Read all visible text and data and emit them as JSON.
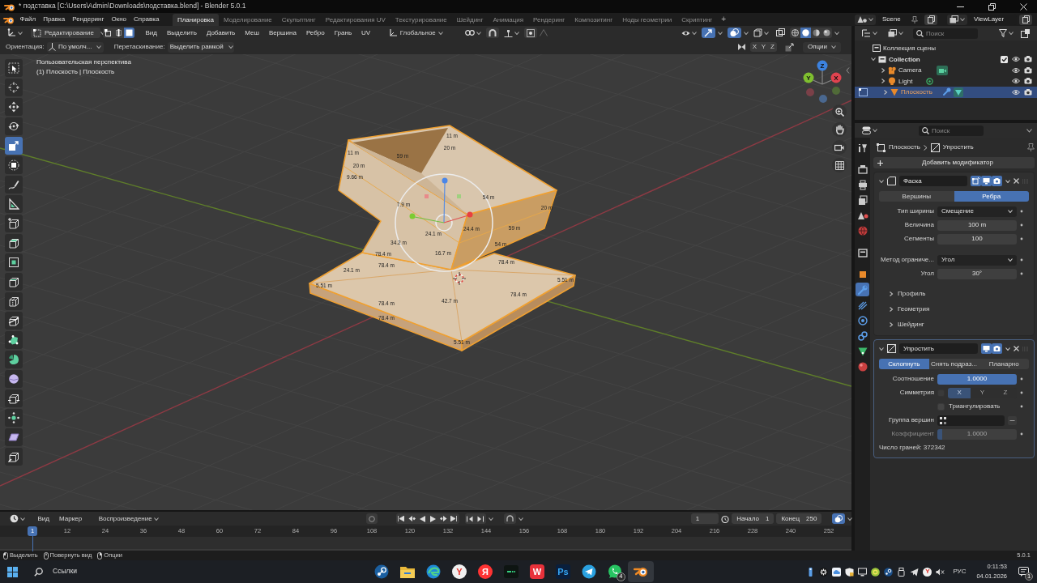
{
  "window": {
    "title": "* подставка [C:\\Users\\Admin\\Downloads\\подставка.blend] - Blender 5.0.1"
  },
  "top_bar": {
    "menus": [
      "Файл",
      "Правка",
      "Рендеринг",
      "Окно",
      "Справка"
    ],
    "workspaces": [
      {
        "label": "Планировка",
        "selected": true
      },
      {
        "label": "Моделирование",
        "selected": false
      },
      {
        "label": "Скульптинг",
        "selected": false
      },
      {
        "label": "Редактирования UV",
        "selected": false
      },
      {
        "label": "Текстурирование",
        "selected": false
      },
      {
        "label": "Шейдинг",
        "selected": false
      },
      {
        "label": "Анимация",
        "selected": false
      },
      {
        "label": "Рендеринг",
        "selected": false
      },
      {
        "label": "Композитинг",
        "selected": false
      },
      {
        "label": "Ноды геометрии",
        "selected": false
      },
      {
        "label": "Скриптинг",
        "selected": false
      }
    ],
    "add_workspace": "+",
    "scene": "Scene",
    "view_layer": "ViewLayer"
  },
  "viewport": {
    "header": {
      "mode": "Редактирование",
      "select_modes": [
        {
          "kind": "vertex",
          "selected": false
        },
        {
          "kind": "edge",
          "selected": false
        },
        {
          "kind": "face",
          "selected": true
        }
      ],
      "menus": [
        "Вид",
        "Выделить",
        "Добавить",
        "Меш",
        "Вершина",
        "Ребро",
        "Грань",
        "UV"
      ],
      "orientation": "Глобальное",
      "shading": [
        {
          "kind": "wireframe",
          "selected": false
        },
        {
          "kind": "solid",
          "selected": true
        },
        {
          "kind": "material",
          "selected": false
        },
        {
          "kind": "rendered",
          "selected": false
        }
      ]
    },
    "tool_settings": {
      "orientation_label": "Ориентация:",
      "orientation": "По умолч...",
      "drag_label": "Перетаскивание:",
      "drag": "Выделить рамкой",
      "mirror": [
        {
          "label": "X",
          "selected": false
        },
        {
          "label": "Y",
          "selected": false
        },
        {
          "label": "Z",
          "selected": false
        }
      ],
      "options": "Опции"
    },
    "view_name": "Пользовательская перспектива",
    "object_info": "(1) Плоскость | Плоскость",
    "tools": [
      {
        "kind": "select-box",
        "selected": false
      },
      {
        "kind": "cursor",
        "selected": false
      },
      {
        "kind": "move",
        "selected": false
      },
      {
        "kind": "rotate",
        "selected": false
      },
      {
        "kind": "scale",
        "selected": true
      },
      {
        "kind": "transform",
        "selected": false
      },
      {
        "kind": "annotate",
        "selected": false
      },
      {
        "kind": "measure",
        "selected": false
      },
      {
        "kind": "add-cube",
        "selected": false
      },
      {
        "kind": "extrude",
        "selected": false
      },
      {
        "kind": "inset",
        "selected": false
      },
      {
        "kind": "bevel",
        "selected": false
      },
      {
        "kind": "loop-cut",
        "selected": false
      },
      {
        "kind": "knife",
        "selected": false
      },
      {
        "kind": "poly-build",
        "selected": false
      },
      {
        "kind": "spin",
        "selected": false
      },
      {
        "kind": "smooth",
        "selected": false
      },
      {
        "kind": "edge-slide",
        "selected": false
      },
      {
        "kind": "shrink",
        "selected": false
      },
      {
        "kind": "shear",
        "selected": false
      },
      {
        "kind": "rip",
        "selected": false
      }
    ],
    "gizmo_axes": [
      {
        "kind": "z",
        "label": "Z"
      },
      {
        "kind": "y",
        "label": "Y"
      },
      {
        "kind": "x",
        "label": "X"
      }
    ],
    "measurements": [
      "59 m",
      "11 m",
      "20 m",
      "11 m",
      "20 m",
      "9.66 m",
      "7.9 m",
      "54 m",
      "20 m",
      "59 m",
      "24.1 m",
      "24.4 m",
      "34.2 m",
      "16.7 m",
      "78.4 m",
      "78.4 m",
      "78.4 m",
      "24.1 m",
      "5.51 m",
      "42.7 m",
      "78.4 m",
      "78.4 m",
      "78.4 m",
      "5.51 m",
      "5.51 m",
      "54 m"
    ]
  },
  "timeline": {
    "menus": [
      "Вид",
      "Маркер"
    ],
    "playback": "Воспроизведение",
    "current_frame": "1",
    "start_label": "Начало",
    "start": "1",
    "end_label": "Конец",
    "end": "250",
    "ruler": [
      "12",
      "24",
      "36",
      "48",
      "60",
      "72",
      "84",
      "96",
      "108",
      "120",
      "132",
      "144",
      "156",
      "168",
      "180",
      "192",
      "204",
      "216",
      "228",
      "240",
      "252"
    ],
    "cursor": "1"
  },
  "outliner": {
    "search_placeholder": "Поиск",
    "scene_collection": "Коллекция сцены",
    "collections": [
      {
        "name": "Collection",
        "expanded": true,
        "checked": true,
        "children": [
          {
            "name": "Camera",
            "kind": "camera",
            "expanded": false,
            "selected": false
          },
          {
            "name": "Light",
            "kind": "light",
            "expanded": false,
            "selected": false
          },
          {
            "name": "Плоскость",
            "kind": "mesh",
            "expanded": false,
            "selected": true
          }
        ]
      }
    ]
  },
  "properties": {
    "search_placeholder": "Поиск",
    "tabs": [
      {
        "kind": "tool",
        "selected": false
      },
      {
        "kind": "render",
        "selected": false
      },
      {
        "kind": "output",
        "selected": false
      },
      {
        "kind": "view-layer",
        "selected": false
      },
      {
        "kind": "scene",
        "selected": false
      },
      {
        "kind": "world",
        "selected": false
      },
      {
        "kind": "collection",
        "selected": false
      },
      {
        "kind": "object",
        "selected": false
      },
      {
        "kind": "modifier",
        "selected": true
      },
      {
        "kind": "particles",
        "selected": false
      },
      {
        "kind": "physics",
        "selected": false
      },
      {
        "kind": "constraints",
        "selected": false
      },
      {
        "kind": "data",
        "selected": false
      },
      {
        "kind": "material",
        "selected": false
      }
    ],
    "breadcrumb": {
      "object": "Плоскость",
      "modifier": "Упростить"
    },
    "add_modifier": "Добавить модификатор",
    "modifiers": [
      {
        "kind": "bevel",
        "name": "Фаска",
        "expanded": true,
        "toggles": [
          {
            "kind": "edit-mode",
            "on": true
          },
          {
            "kind": "viewport",
            "on": true
          },
          {
            "kind": "render",
            "on": true
          }
        ],
        "affect": [
          {
            "label": "Вершины",
            "selected": false
          },
          {
            "label": "Ребра",
            "selected": true
          }
        ],
        "fields": [
          {
            "kind": "dropdown",
            "label": "Тип ширины",
            "value": "Смещение"
          },
          {
            "kind": "number",
            "label": "Величина",
            "value": "100 m"
          },
          {
            "kind": "number",
            "label": "Сегменты",
            "value": "100"
          },
          {
            "kind": "dropdown",
            "label": "Метод ограниче...",
            "value": "Угол"
          },
          {
            "kind": "number",
            "label": "Угол",
            "value": "30°"
          }
        ],
        "subpanels": [
          {
            "label": "Профиль",
            "expanded": false
          },
          {
            "label": "Геометрия",
            "expanded": false
          },
          {
            "label": "Шейдинг",
            "expanded": false
          }
        ]
      },
      {
        "kind": "decimate",
        "name": "Упростить",
        "expanded": true,
        "toggles": [
          {
            "kind": "viewport",
            "on": true
          },
          {
            "kind": "render",
            "on": true
          }
        ],
        "affect": [
          {
            "label": "Склопнуть",
            "selected": true
          },
          {
            "label": "Снять подраз...",
            "selected": false
          },
          {
            "label": "Планарно",
            "selected": false
          }
        ],
        "fields": [
          {
            "kind": "slider",
            "label": "Соотношение",
            "value": "1.0000",
            "level": 1
          },
          {
            "kind": "axes",
            "label": "Симметрия",
            "checked": false,
            "axes": [
              {
                "label": "X",
                "selected": true
              },
              {
                "label": "Y",
                "selected": false
              },
              {
                "label": "Z",
                "selected": false
              }
            ]
          },
          {
            "kind": "checkbox",
            "label": "Триангулировать",
            "checked": false
          },
          {
            "kind": "group",
            "label": "Группа вершин"
          },
          {
            "kind": "slider",
            "label": "Коэффициент",
            "value": "1.0000",
            "level": 0.06,
            "disabled": true
          }
        ],
        "face_count": "Число граней: 372342"
      }
    ]
  },
  "status_bar": {
    "hints": [
      {
        "kind": "left-click",
        "label": "Выделить"
      },
      {
        "kind": "middle-click",
        "label": "Повернуть вид"
      },
      {
        "kind": "right-click",
        "label": "Опции"
      }
    ],
    "version": "5.0.1"
  },
  "taskbar": {
    "search": "Ссылки",
    "apps": [
      {
        "kind": "steam",
        "selected": false
      },
      {
        "kind": "folder",
        "selected": false
      },
      {
        "kind": "edge",
        "selected": false
      },
      {
        "kind": "y-browser",
        "label": "Y",
        "selected": false
      },
      {
        "kind": "yandex",
        "label": "Я",
        "selected": false
      },
      {
        "kind": "terminal",
        "selected": false
      },
      {
        "kind": "wps",
        "label": "W",
        "selected": false
      },
      {
        "kind": "ps",
        "label": "Ps",
        "selected": false
      },
      {
        "kind": "telegram",
        "selected": false
      },
      {
        "kind": "whatsapp",
        "badge": "4",
        "selected": false
      },
      {
        "kind": "blender",
        "selected": true
      }
    ],
    "tray_logo": "Y",
    "language": "РУС",
    "time": "0:11:53",
    "date": "04.01.2026",
    "notifications": "1"
  }
}
